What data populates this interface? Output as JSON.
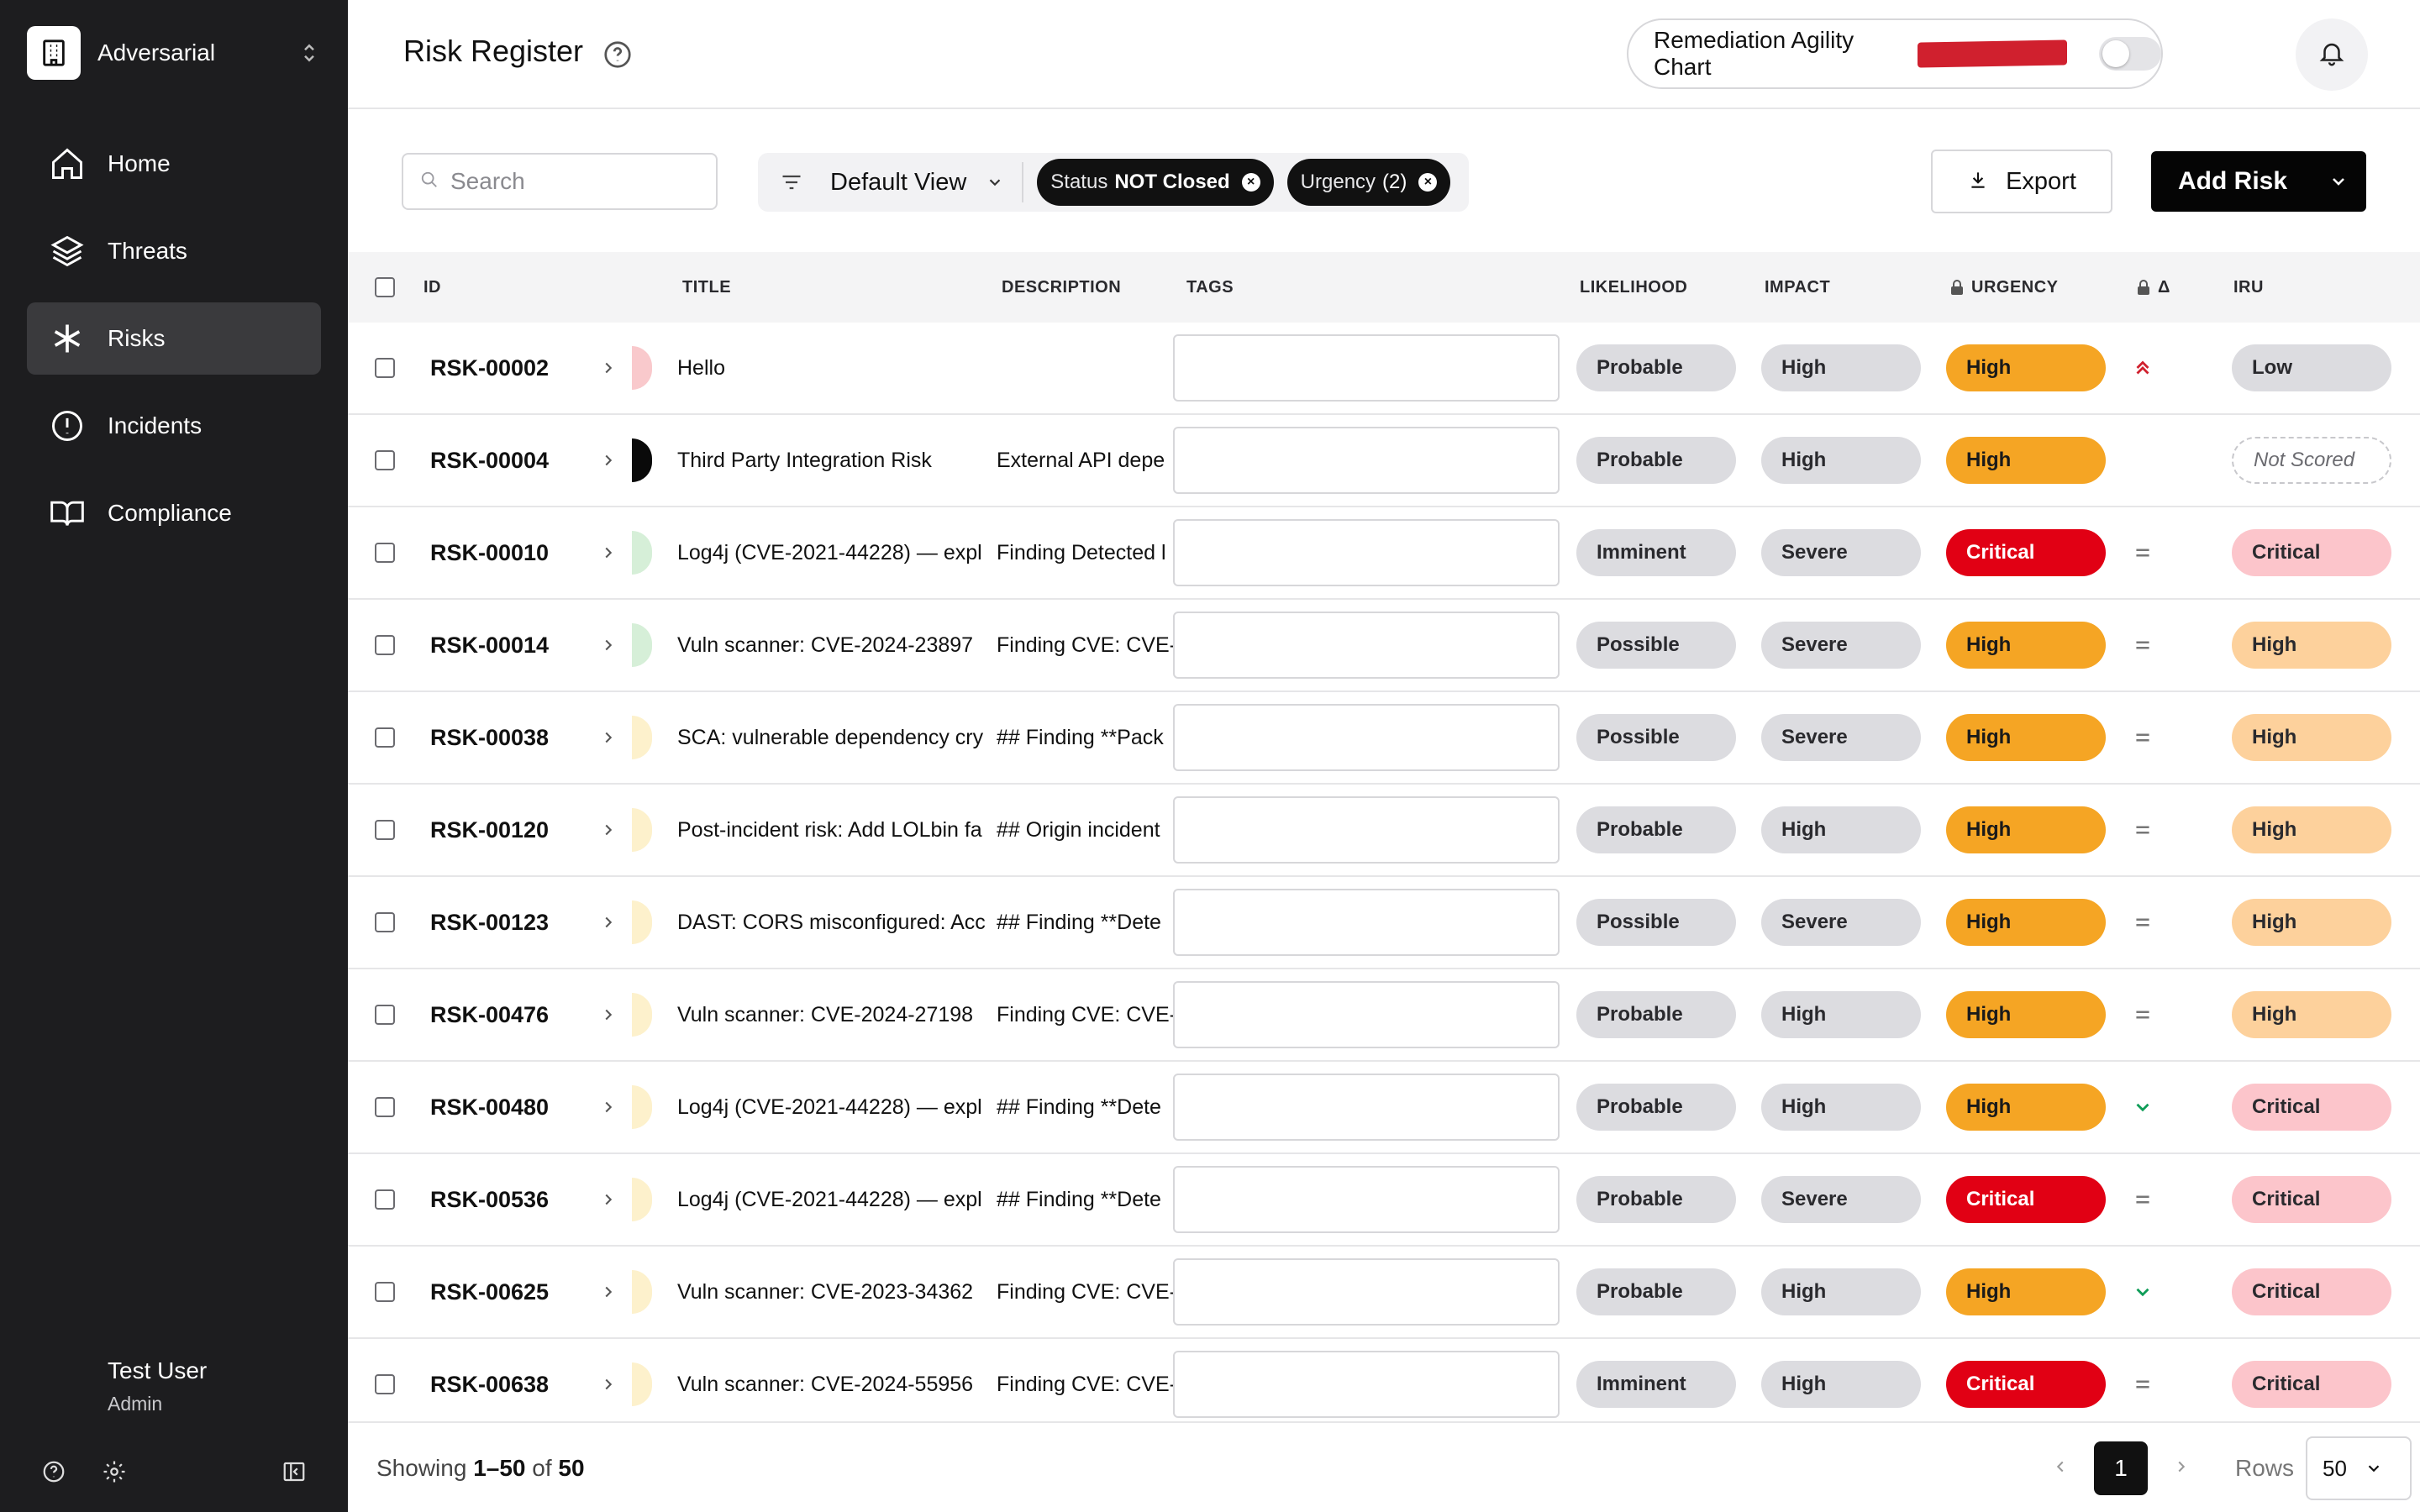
{
  "sidebar": {
    "org_name": "Adversarial",
    "nav": [
      {
        "label": "Home",
        "icon": "home-icon"
      },
      {
        "label": "Threats",
        "icon": "layers-icon"
      },
      {
        "label": "Risks",
        "icon": "asterisk-icon"
      },
      {
        "label": "Incidents",
        "icon": "alert-circle-icon"
      },
      {
        "label": "Compliance",
        "icon": "book-icon"
      }
    ],
    "active_nav": "Risks",
    "user_name": "Test User",
    "user_role": "Admin"
  },
  "header": {
    "title": "Risk Register",
    "chart_toggle_label": "Remediation Agility Chart",
    "chart_toggle_on": false
  },
  "toolbar": {
    "search_placeholder": "Search",
    "view_label": "Default View",
    "chips": [
      {
        "key": "Status",
        "value": "NOT Closed"
      },
      {
        "key": "Urgency",
        "value": "(2)"
      }
    ],
    "export_label": "Export",
    "add_label": "Add Risk"
  },
  "table": {
    "columns": {
      "id": "ID",
      "title": "TITLE",
      "description": "DESCRIPTION",
      "tags": "TAGS",
      "likelihood": "LIKELIHOOD",
      "impact": "IMPACT",
      "urgency": "URGENCY",
      "delta": "Δ",
      "iru": "IRU"
    },
    "rows": [
      {
        "id": "RSK-00002",
        "indicator": "#f9c9cc",
        "title": "Hello",
        "description": "",
        "likelihood": "Probable",
        "impact": "High",
        "urgency": "High",
        "delta": "up",
        "iru": "Low"
      },
      {
        "id": "RSK-00004",
        "indicator": "#0a0a0a",
        "title": "Third Party Integration Risk",
        "description": "External API depe",
        "likelihood": "Probable",
        "impact": "High",
        "urgency": "High",
        "delta": "none",
        "iru": "Not Scored"
      },
      {
        "id": "RSK-00010",
        "indicator": "#d6efd8",
        "title": "Log4j (CVE-2021-44228) — expl",
        "description": "Finding Detected l",
        "likelihood": "Imminent",
        "impact": "Severe",
        "urgency": "Critical",
        "delta": "equal",
        "iru": "Critical"
      },
      {
        "id": "RSK-00014",
        "indicator": "#d6efd8",
        "title": "Vuln scanner: CVE-2024-23897",
        "description": "Finding CVE: CVE-",
        "likelihood": "Possible",
        "impact": "Severe",
        "urgency": "High",
        "delta": "equal",
        "iru": "High"
      },
      {
        "id": "RSK-00038",
        "indicator": "#fdf1cc",
        "title": "SCA: vulnerable dependency cry",
        "description": "## Finding **Pack",
        "likelihood": "Possible",
        "impact": "Severe",
        "urgency": "High",
        "delta": "equal",
        "iru": "High"
      },
      {
        "id": "RSK-00120",
        "indicator": "#fdf1cc",
        "title": "Post-incident risk: Add LOLbin fa",
        "description": "## Origin incident",
        "likelihood": "Probable",
        "impact": "High",
        "urgency": "High",
        "delta": "equal",
        "iru": "High"
      },
      {
        "id": "RSK-00123",
        "indicator": "#fdf1cc",
        "title": "DAST: CORS misconfigured: Acc",
        "description": "## Finding **Dete",
        "likelihood": "Possible",
        "impact": "Severe",
        "urgency": "High",
        "delta": "equal",
        "iru": "High"
      },
      {
        "id": "RSK-00476",
        "indicator": "#fdf1cc",
        "title": "Vuln scanner: CVE-2024-27198",
        "description": "Finding CVE: CVE-",
        "likelihood": "Probable",
        "impact": "High",
        "urgency": "High",
        "delta": "equal",
        "iru": "High"
      },
      {
        "id": "RSK-00480",
        "indicator": "#fdf1cc",
        "title": "Log4j (CVE-2021-44228) — expl",
        "description": "## Finding **Dete",
        "likelihood": "Probable",
        "impact": "High",
        "urgency": "High",
        "delta": "down",
        "iru": "Critical"
      },
      {
        "id": "RSK-00536",
        "indicator": "#fdf1cc",
        "title": "Log4j (CVE-2021-44228) — expl",
        "description": "## Finding **Dete",
        "likelihood": "Probable",
        "impact": "Severe",
        "urgency": "Critical",
        "delta": "equal",
        "iru": "Critical"
      },
      {
        "id": "RSK-00625",
        "indicator": "#fdf1cc",
        "title": "Vuln scanner: CVE-2023-34362",
        "description": "Finding CVE: CVE-",
        "likelihood": "Probable",
        "impact": "High",
        "urgency": "High",
        "delta": "down",
        "iru": "Critical"
      },
      {
        "id": "RSK-00638",
        "indicator": "#fdf1cc",
        "title": "Vuln scanner: CVE-2024-55956",
        "description": "Finding CVE: CVE-",
        "likelihood": "Imminent",
        "impact": "High",
        "urgency": "Critical",
        "delta": "equal",
        "iru": "Critical"
      }
    ]
  },
  "footer": {
    "showing_prefix": "Showing",
    "showing_range": "1–50",
    "showing_of": "of",
    "showing_total": "50",
    "current_page": "1",
    "rows_label": "Rows",
    "rows_value": "50"
  },
  "colors": {
    "sidebar_bg": "#1d1d1f",
    "urgency_high": "#f5a524",
    "urgency_critical": "#e10014",
    "iru_high": "#fdd19c",
    "iru_critical": "#fcc5cb",
    "delta_up": "#d0202e",
    "delta_down": "#0f9d58"
  }
}
